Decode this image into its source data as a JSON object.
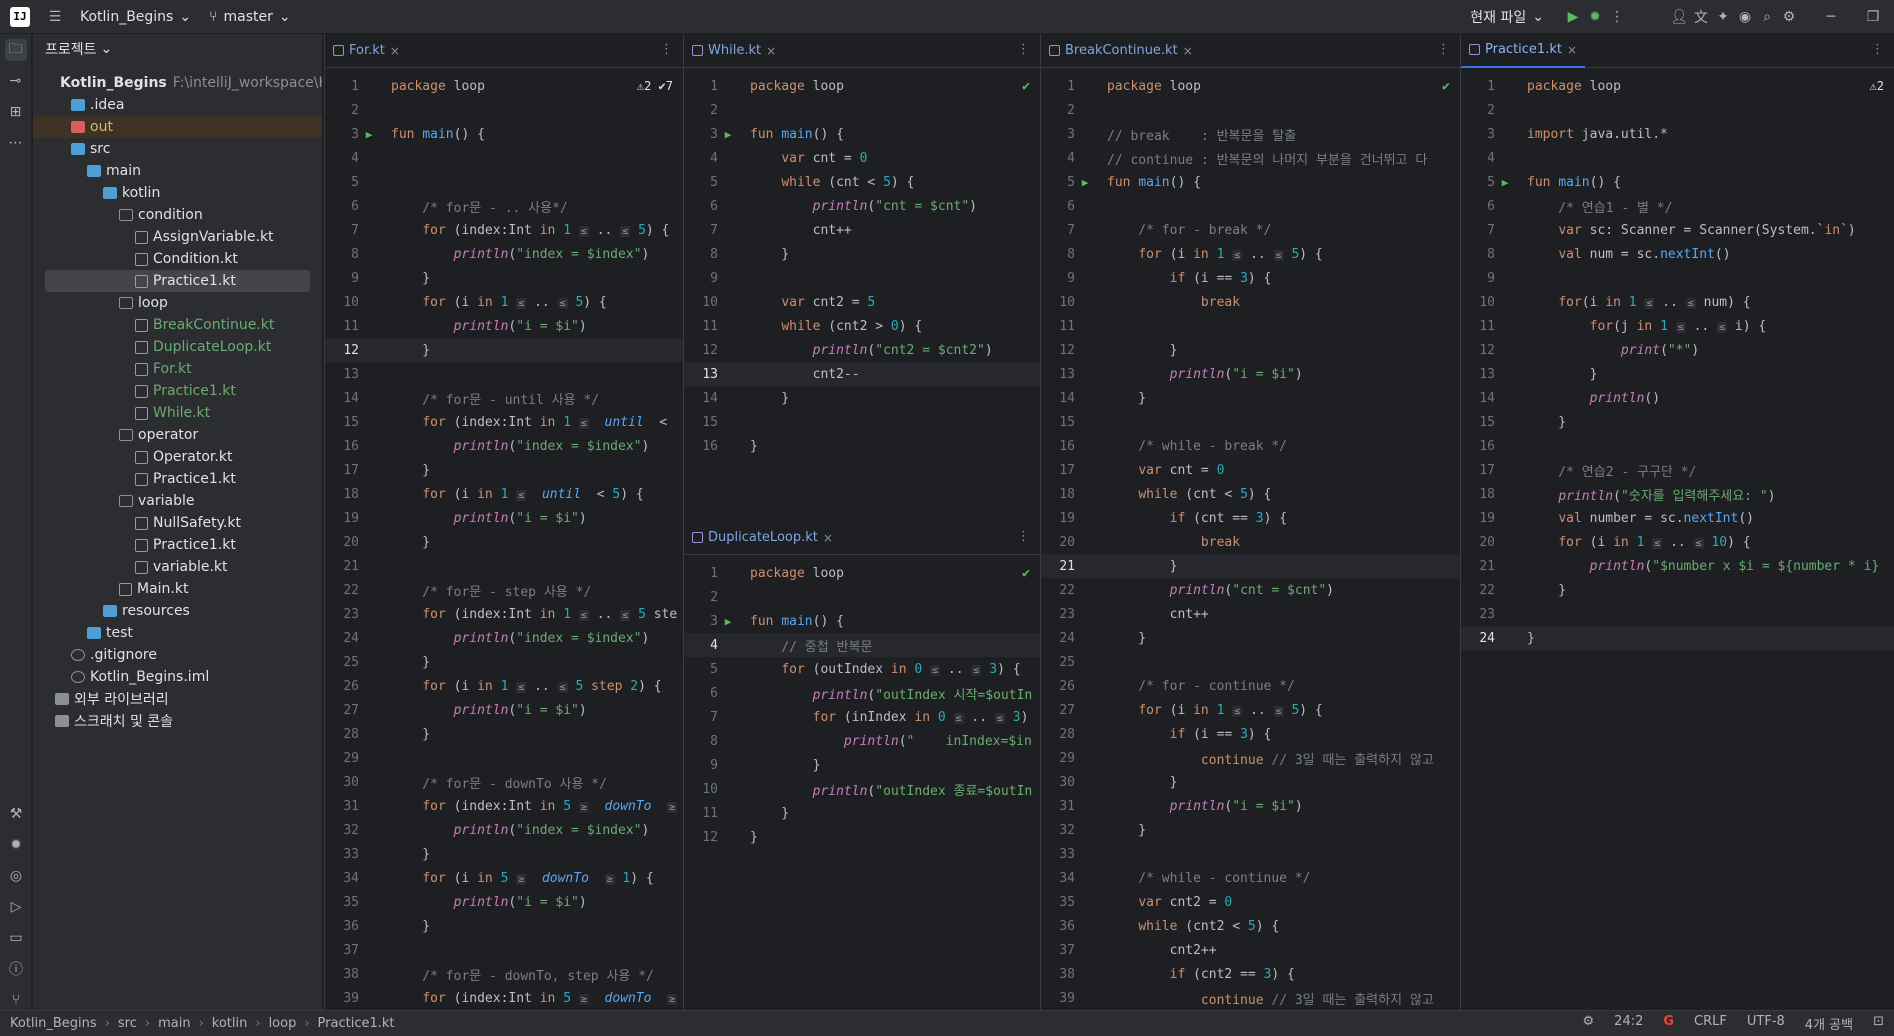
{
  "titlebar": {
    "project_name": "Kotlin_Begins",
    "branch": "master",
    "run_config": "현재 파일"
  },
  "project_panel": {
    "title": "프로젝트",
    "tree": [
      {
        "label": "Kotlin_Begins",
        "extra": "F:\\intelliJ_workspace\\K",
        "level": 0,
        "kind": "module"
      },
      {
        "label": ".idea",
        "level": 1,
        "kind": "folder"
      },
      {
        "label": "out",
        "level": 1,
        "kind": "folder-out"
      },
      {
        "label": "src",
        "level": 1,
        "kind": "folder"
      },
      {
        "label": "main",
        "level": 2,
        "kind": "folder"
      },
      {
        "label": "kotlin",
        "level": 3,
        "kind": "folder"
      },
      {
        "label": "condition",
        "level": 4,
        "kind": "package"
      },
      {
        "label": "AssignVariable.kt",
        "level": 5,
        "kind": "kt"
      },
      {
        "label": "Condition.kt",
        "level": 5,
        "kind": "kt"
      },
      {
        "label": "Practice1.kt",
        "level": 5,
        "kind": "kt",
        "selected": true
      },
      {
        "label": "loop",
        "level": 4,
        "kind": "package"
      },
      {
        "label": "BreakContinue.kt",
        "level": 5,
        "kind": "kt",
        "color": "green"
      },
      {
        "label": "DuplicateLoop.kt",
        "level": 5,
        "kind": "kt",
        "color": "green"
      },
      {
        "label": "For.kt",
        "level": 5,
        "kind": "kt",
        "color": "green"
      },
      {
        "label": "Practice1.kt",
        "level": 5,
        "kind": "kt",
        "color": "green"
      },
      {
        "label": "While.kt",
        "level": 5,
        "kind": "kt",
        "color": "green"
      },
      {
        "label": "operator",
        "level": 4,
        "kind": "package"
      },
      {
        "label": "Operator.kt",
        "level": 5,
        "kind": "kt"
      },
      {
        "label": "Practice1.kt",
        "level": 5,
        "kind": "kt"
      },
      {
        "label": "variable",
        "level": 4,
        "kind": "package"
      },
      {
        "label": "NullSafety.kt",
        "level": 5,
        "kind": "kt"
      },
      {
        "label": "Practice1.kt",
        "level": 5,
        "kind": "kt"
      },
      {
        "label": "variable.kt",
        "level": 5,
        "kind": "kt"
      },
      {
        "label": "Main.kt",
        "level": 4,
        "kind": "kt"
      },
      {
        "label": "resources",
        "level": 3,
        "kind": "folder"
      },
      {
        "label": "test",
        "level": 2,
        "kind": "folder"
      },
      {
        "label": ".gitignore",
        "level": 1,
        "kind": "file"
      },
      {
        "label": "Kotlin_Begins.iml",
        "level": 1,
        "kind": "file"
      },
      {
        "label": "외부 라이브러리",
        "level": 0,
        "kind": "lib"
      },
      {
        "label": "스크래치 및 콘솔",
        "level": 0,
        "kind": "scratch"
      }
    ]
  },
  "editors": [
    {
      "tab": "For.kt",
      "inspection": "⚠2 ✔7",
      "first_line": 1,
      "current_line": 12,
      "lines": [
        "package loop",
        "",
        "fun main() {",
        "",
        "",
        "    /* for문 - .. 사용*/",
        "    for (index:Int in 1 ≤ .. ≤ 5) {",
        "        println(\"index = $index\")",
        "    }",
        "    for (i in 1 ≤ .. ≤ 5) {",
        "        println(\"i = $i\")",
        "    }",
        "",
        "    /* for문 - until 사용 */",
        "    for (index:Int in 1 ≤  until  <",
        "        println(\"index = $index\")",
        "    }",
        "    for (i in 1 ≤  until  < 5) {",
        "        println(\"i = $i\")",
        "    }",
        "",
        "    /* for문 - step 사용 */",
        "    for (index:Int in 1 ≤ .. ≤ 5 ste",
        "        println(\"index = $index\")",
        "    }",
        "    for (i in 1 ≤ .. ≤ 5 step 2) {",
        "        println(\"i = $i\")",
        "    }",
        "",
        "    /* for문 - downTo 사용 */",
        "    for (index:Int in 5 ≥  downTo  ≥",
        "        println(\"index = $index\")",
        "    }",
        "    for (i in 5 ≥  downTo  ≥ 1) {",
        "        println(\"i = $i\")",
        "    }",
        "",
        "    /* for문 - downTo, step 사용 */",
        "    for (index:Int in 5 ≥  downTo  ≥"
      ],
      "run_lines": [
        3
      ]
    },
    {
      "tab": "While.kt",
      "first_line": 1,
      "current_line": 13,
      "lines": [
        "package loop",
        "",
        "fun main() {",
        "    var cnt = 0",
        "    while (cnt < 5) {",
        "        println(\"cnt = $cnt\")",
        "        cnt++",
        "    }",
        "",
        "    var cnt2 = 5",
        "    while (cnt2 > 0) {",
        "        println(\"cnt2 = $cnt2\")",
        "        cnt2--",
        "    }",
        "",
        "}"
      ],
      "run_lines": [
        3
      ]
    },
    {
      "tab": "DuplicateLoop.kt",
      "first_line": 1,
      "current_line": 4,
      "lines": [
        "package loop",
        "",
        "fun main() {",
        "    // 중첩 반복문",
        "    for (outIndex in 0 ≤ .. ≤ 3) {",
        "        println(\"outIndex 시작=$outIn",
        "        for (inIndex in 0 ≤ .. ≤ 3)",
        "            println(\"    inIndex=$in",
        "        }",
        "        println(\"outIndex 종료=$outIn",
        "    }",
        "}"
      ],
      "run_lines": [
        3
      ]
    },
    {
      "tab": "BreakContinue.kt",
      "first_line": 1,
      "current_line": 21,
      "lines": [
        "package loop",
        "",
        "// break    : 반복문을 탈출",
        "// continue : 반복문의 나머지 부분을 건너뛰고 다",
        "fun main() {",
        "",
        "    /* for - break */",
        "    for (i in 1 ≤ .. ≤ 5) {",
        "        if (i == 3) {",
        "            break",
        "",
        "        }",
        "        println(\"i = $i\")",
        "    }",
        "",
        "    /* while - break */",
        "    var cnt = 0",
        "    while (cnt < 5) {",
        "        if (cnt == 3) {",
        "            break",
        "        }",
        "        println(\"cnt = $cnt\")",
        "        cnt++",
        "    }",
        "",
        "    /* for - continue */",
        "    for (i in 1 ≤ .. ≤ 5) {",
        "        if (i == 3) {",
        "            continue // 3일 때는 출력하지 않고",
        "        }",
        "        println(\"i = $i\")",
        "    }",
        "",
        "    /* while - continue */",
        "    var cnt2 = 0",
        "    while (cnt2 < 5) {",
        "        cnt2++",
        "        if (cnt2 == 3) {",
        "            continue // 3일 때는 출력하지 않고"
      ],
      "run_lines": [
        5
      ]
    },
    {
      "tab": "Practice1.kt",
      "inspection": "⚠2",
      "first_line": 1,
      "current_line": 24,
      "lines": [
        "package loop",
        "",
        "import java.util.*",
        "",
        "fun main() {",
        "    /* 연습1 - 별 */",
        "    var sc: Scanner = Scanner(System.`in`)",
        "    val num = sc.nextInt()",
        "",
        "    for(i in 1 ≤ .. ≤ num) {",
        "        for(j in 1 ≤ .. ≤ i) {",
        "            print(\"*\")",
        "        }",
        "        println()",
        "    }",
        "",
        "    /* 연습2 - 구구단 */",
        "    println(\"숫자를 입력해주세요: \")",
        "    val number = sc.nextInt()",
        "    for (i in 1 ≤ .. ≤ 10) {",
        "        println(\"$number x $i = ${number * i}",
        "    }",
        "",
        "}"
      ],
      "run_lines": [
        5
      ]
    }
  ],
  "statusbar": {
    "breadcrumbs": [
      "Kotlin_Begins",
      "src",
      "main",
      "kotlin",
      "loop",
      "Practice1.kt"
    ],
    "position": "24:2",
    "line_sep": "CRLF",
    "encoding": "UTF-8",
    "indent": "4개 공백"
  },
  "colors": {
    "accent": "#3574f0",
    "background": "#1e1f22",
    "panel": "#2b2d30",
    "keyword": "#cf8e6d",
    "string": "#6aab73",
    "function": "#56a8f5"
  }
}
